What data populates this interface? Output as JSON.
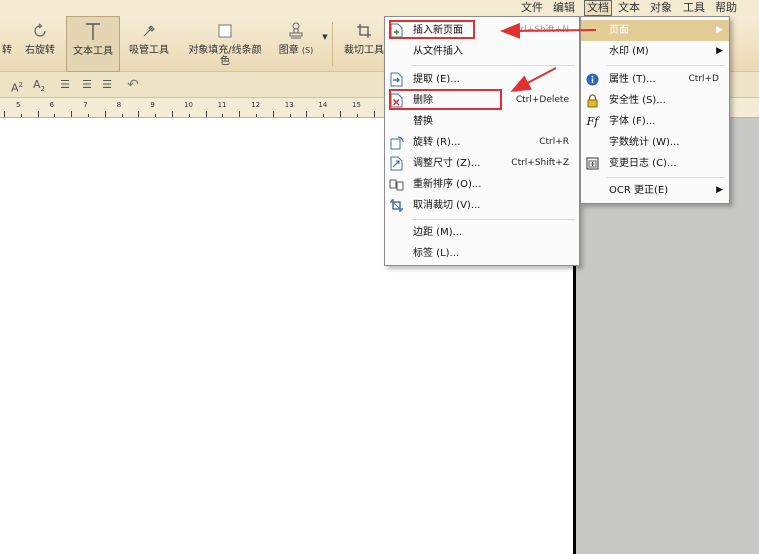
{
  "menubar": {
    "items": [
      "文件",
      "编辑",
      "文档",
      "文本",
      "对象",
      "工具",
      "帮助"
    ]
  },
  "toolbar": {
    "rotate_partial": "转",
    "rotate_right": "右旋转",
    "text_tool": "文本工具",
    "eyedropper": "吸管工具",
    "fill_color_1": "对象填充/线条颜",
    "fill_color_2": "色",
    "stamp": "图章",
    "stamp_key": "(S)",
    "crop": "裁切工具"
  },
  "fmtbar": {
    "superscript": "A",
    "subscript": "A"
  },
  "ruler": {
    "numbers": [
      "5",
      "6",
      "7",
      "8",
      "9",
      "10",
      "11",
      "12",
      "13",
      "14",
      "15"
    ]
  },
  "doc_menu": {
    "items": [
      {
        "label": "插入新页面",
        "shortcut": "Ctrl+Shift+N"
      },
      {
        "label": "从文件插入",
        "shortcut": ""
      },
      {
        "label": "提取 (E)...",
        "shortcut": ""
      },
      {
        "label": "删除",
        "shortcut": "Ctrl+Delete"
      },
      {
        "label": "替换",
        "shortcut": ""
      },
      {
        "label": "旋转 (R)...",
        "shortcut": "Ctrl+R"
      },
      {
        "label": "调整尺寸 (Z)...",
        "shortcut": "Ctrl+Shift+Z"
      },
      {
        "label": "重新排序 (O)...",
        "shortcut": ""
      },
      {
        "label": "取消裁切 (V)...",
        "shortcut": ""
      },
      {
        "label": "边距 (M)...",
        "shortcut": ""
      },
      {
        "label": "标签 (L)...",
        "shortcut": ""
      }
    ]
  },
  "page_submenu": {
    "items": [
      {
        "label": "页面",
        "shortcut": ""
      },
      {
        "label": "水印 (M)",
        "shortcut": ""
      },
      {
        "label": "属性 (T)...",
        "shortcut": "Ctrl+D"
      },
      {
        "label": "安全性 (S)...",
        "shortcut": ""
      },
      {
        "label": "字体 (F)...",
        "shortcut": ""
      },
      {
        "label": "字数统计 (W)...",
        "shortcut": ""
      },
      {
        "label": "变更日志 (C)...",
        "shortcut": ""
      },
      {
        "label": "OCR 更正(E)",
        "shortcut": ""
      }
    ]
  },
  "colors": {
    "annotation_red": "#e03030",
    "highlight": "#e4cc96",
    "toolbar_bg": "#f0e4c8"
  }
}
